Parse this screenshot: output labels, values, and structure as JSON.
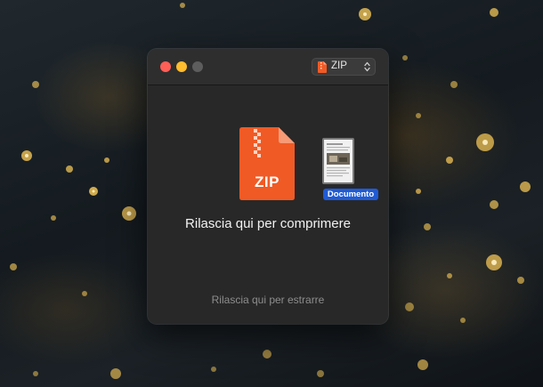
{
  "window": {
    "format_selector": {
      "value": "ZIP",
      "icon": "zip-file-icon"
    },
    "archive_icon": {
      "name": "zip-archive-icon",
      "label": "ZIP",
      "color": "#f05a25"
    },
    "dragged_item": {
      "name": "document-thumbnail",
      "label": "Documento",
      "badge_color": "#1f5bd6"
    },
    "compress_hint": "Rilascia qui per comprimere",
    "extract_hint": "Rilascia qui per estrarre"
  },
  "colors": {
    "close": "#fe5f57",
    "minimize": "#febc2e",
    "zoom_disabled": "#5d5d5d",
    "window_bg": "#282828"
  }
}
